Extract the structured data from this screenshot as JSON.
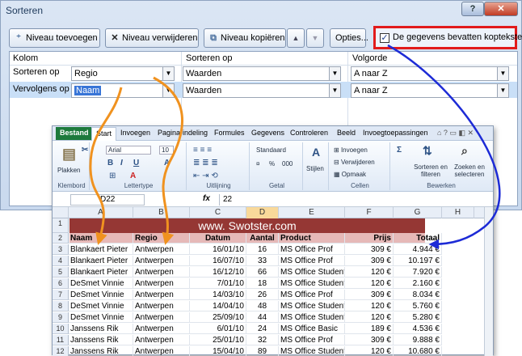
{
  "dialog": {
    "title": "Sorteren",
    "help": "?",
    "close": "✕"
  },
  "toolbar": {
    "add_level": "Niveau toevoegen",
    "delete_level": "Niveau verwijderen",
    "copy_level": "Niveau kopiëren",
    "up": "▲",
    "down": "▼",
    "options": "Opties...",
    "has_headers_label": "De gegevens bevatten kopteksten",
    "has_headers_checked": true
  },
  "grid": {
    "col_headers": [
      "Kolom",
      "Sorteren op",
      "Volgorde"
    ],
    "rows": [
      {
        "label": "Sorteren op",
        "column": "Regio",
        "sort_on": "Waarden",
        "order": "A naar Z"
      },
      {
        "label": "Vervolgens op",
        "column": "Naam",
        "sort_on": "Waarden",
        "order": "A naar Z"
      }
    ]
  },
  "excel": {
    "tabs": [
      "Bestand",
      "Start",
      "Invoegen",
      "Pagina-indeling",
      "Formules",
      "Gegevens",
      "Controleren",
      "Beeld",
      "Invoegtoepassingen"
    ],
    "ribbon": {
      "clipboard": "Klembord",
      "paste": "Plakken",
      "font": "Lettertype",
      "font_name": "Arial",
      "font_size": "10",
      "alignment": "Uitlijning",
      "number": "Getal",
      "number_format": "Standaard",
      "styles": "Stijlen",
      "cells": "Cellen",
      "insert": "Invoegen",
      "delete": "Verwijderen",
      "format": "Opmaak",
      "editing": "Bewerken",
      "sort_filter": "Sorteren en filteren",
      "find_select": "Zoeken en selecteren",
      "percent": "%",
      "thousands": "000"
    },
    "name_box": "D22",
    "fx": "fx",
    "formula_value": "22",
    "columns": [
      "A",
      "B",
      "C",
      "D",
      "E",
      "F",
      "G",
      "H"
    ],
    "banner": "www. Swotster.com",
    "headers": [
      "Naam",
      "Regio",
      "Datum",
      "Aantal",
      "Product",
      "Prijs",
      "Totaal"
    ],
    "rows": [
      [
        "Blankaert Pieter",
        "Antwerpen",
        "16/01/10",
        "16",
        "MS Office Prof",
        "309 €",
        "4.944 €"
      ],
      [
        "Blankaert Pieter",
        "Antwerpen",
        "16/07/10",
        "33",
        "MS Office Prof",
        "309 €",
        "10.197 €"
      ],
      [
        "Blankaert Pieter",
        "Antwerpen",
        "16/12/10",
        "66",
        "MS Office Student",
        "120 €",
        "7.920 €"
      ],
      [
        "DeSmet Vinnie",
        "Antwerpen",
        "7/01/10",
        "18",
        "MS Office Student",
        "120 €",
        "2.160 €"
      ],
      [
        "DeSmet Vinnie",
        "Antwerpen",
        "14/03/10",
        "26",
        "MS Office Prof",
        "309 €",
        "8.034 €"
      ],
      [
        "DeSmet Vinnie",
        "Antwerpen",
        "14/04/10",
        "48",
        "MS Office Student",
        "120 €",
        "5.760 €"
      ],
      [
        "DeSmet Vinnie",
        "Antwerpen",
        "25/09/10",
        "44",
        "MS Office Student",
        "120 €",
        "5.280 €"
      ],
      [
        "Janssens Rik",
        "Antwerpen",
        "6/01/10",
        "24",
        "MS Office Basic",
        "189 €",
        "4.536 €"
      ],
      [
        "Janssens Rik",
        "Antwerpen",
        "25/01/10",
        "32",
        "MS Office Prof",
        "309 €",
        "9.888 €"
      ],
      [
        "Janssens Rik",
        "Antwerpen",
        "15/04/10",
        "89",
        "MS Office Student",
        "120 €",
        "10.680 €"
      ]
    ]
  },
  "colors": {
    "highlight": "#e21b1b",
    "arrow_orange": "#f0921f",
    "arrow_blue": "#1d2bd6",
    "banner": "#953734",
    "header_row": "#e6b9b8"
  }
}
